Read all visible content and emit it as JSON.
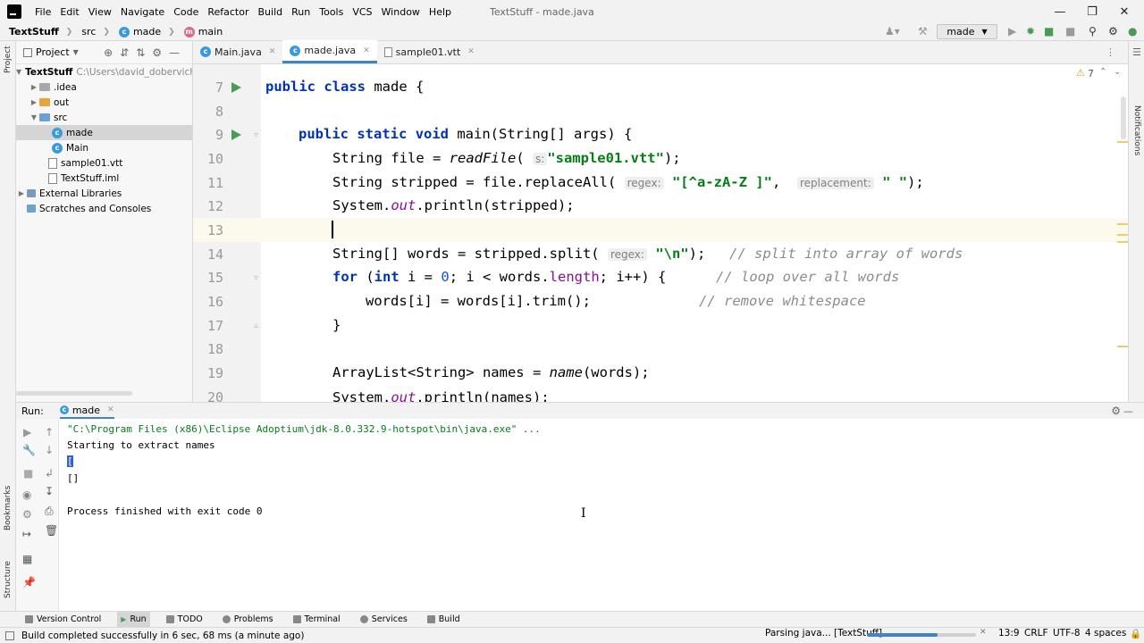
{
  "menubar": {
    "items": [
      "File",
      "Edit",
      "View",
      "Navigate",
      "Code",
      "Refactor",
      "Build",
      "Run",
      "Tools",
      "VCS",
      "Window",
      "Help"
    ],
    "title": "TextStuff - made.java"
  },
  "navbar": {
    "crumbs": [
      "TextStuff",
      "src",
      "made",
      "main"
    ],
    "run_config": "made"
  },
  "project_panel": {
    "title": "Project",
    "tree": [
      {
        "label": "TextStuff",
        "extra": "C:\\Users\\david_dobervich",
        "kind": "root"
      },
      {
        "label": ".idea",
        "kind": "folder"
      },
      {
        "label": "out",
        "kind": "folder"
      },
      {
        "label": "src",
        "kind": "folder"
      },
      {
        "label": "made",
        "kind": "class"
      },
      {
        "label": "Main",
        "kind": "class"
      },
      {
        "label": "sample01.vtt",
        "kind": "file"
      },
      {
        "label": "TextStuff.iml",
        "kind": "file"
      },
      {
        "label": "External Libraries",
        "kind": "lib"
      },
      {
        "label": "Scratches and Consoles",
        "kind": "scratch"
      }
    ]
  },
  "tabs": [
    {
      "label": "Main.java"
    },
    {
      "label": "made.java"
    },
    {
      "label": "sample01.vtt"
    }
  ],
  "inspections": "7",
  "editor": {
    "line_numbers": [
      "7",
      "8",
      "9",
      "10",
      "11",
      "12",
      "13",
      "14",
      "15",
      "16",
      "17",
      "18",
      "19",
      "20"
    ],
    "line7": {
      "kw1": "public",
      "kw2": "class",
      "rest": " made {"
    },
    "line9": {
      "kw1": "public",
      "kw2": "static",
      "kw3": "void",
      "rest": " main(String[] args) {"
    },
    "line10": {
      "a": "String file = ",
      "fn": "readFile",
      "b": "(",
      "hint": "s:",
      "str": "\"sample01.vtt\"",
      "c": ");"
    },
    "line11": {
      "a": "String stripped = file.replaceAll(",
      "hint1": "regex:",
      "str1": "\"[^a-zA-Z ]\"",
      "b": ", ",
      "hint2": "replacement:",
      "str2": "\" \"",
      "c": ");"
    },
    "line12": {
      "a": "System.",
      "fld": "out",
      "b": ".println(stripped);"
    },
    "line14": {
      "a": "String[] words = stripped.split(",
      "hint": "regex:",
      "str": "\"\\n\"",
      "b": ");",
      "comment": "// split into array of words"
    },
    "line15": {
      "kw1": "for",
      "a": " (",
      "kw2": "int",
      "b": " i = ",
      "num": "0",
      "c": "; i < words.",
      "fld": "length",
      "d": "; i++) {",
      "comment": "// loop over all words"
    },
    "line16": {
      "a": "words[i] = words[i].trim();",
      "comment": "// remove whitespace"
    },
    "line17": {
      "a": "}"
    },
    "line19": {
      "a": "ArrayList<String> names = ",
      "fn": "name",
      "b": "(words);"
    },
    "line20": {
      "a": "System.",
      "fld": "out",
      "b": ".println(names);"
    }
  },
  "run_panel": {
    "label": "Run:",
    "tab": "made",
    "output": [
      "\"C:\\Program Files (x86)\\Eclipse Adoptium\\jdk-8.0.332.9-hotspot\\bin\\java.exe\" ...",
      "Starting to extract names",
      "[",
      "[]",
      "",
      "Process finished with exit code 0"
    ]
  },
  "tool_windows": [
    "Version Control",
    "Run",
    "TODO",
    "Problems",
    "Terminal",
    "Services",
    "Build"
  ],
  "side_labels": {
    "project": "Project",
    "notifications": "Notifications",
    "bookmarks": "Bookmarks",
    "structure": "Structure"
  },
  "status": {
    "message": "Build completed successfully in 6 sec, 68 ms (a minute ago)",
    "task": "Parsing java... [TextStuff]",
    "progress": 0.65,
    "position": "13:9",
    "line_sep": "CRLF",
    "encoding": "UTF-8",
    "indent": "4 spaces"
  },
  "colors": {
    "accent": "#4083c9",
    "keyword": "#0033b3",
    "string": "#067d17",
    "run": "#499c54"
  }
}
